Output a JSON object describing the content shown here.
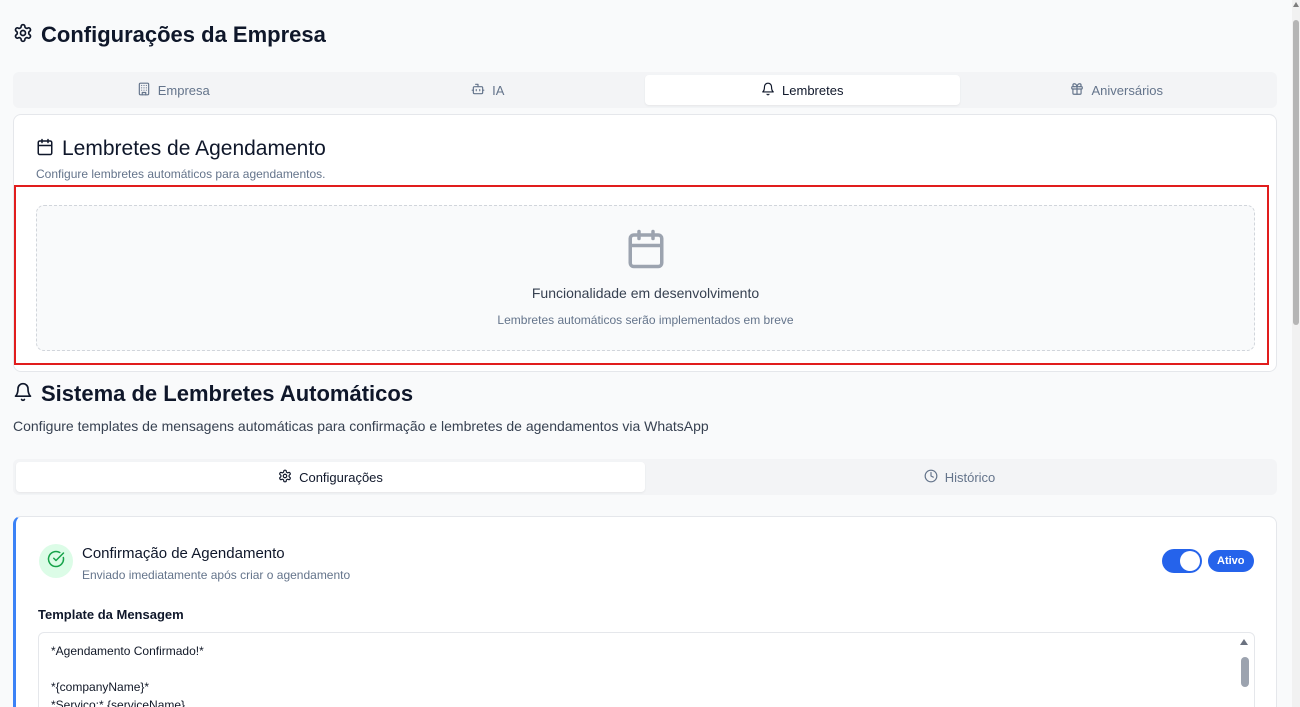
{
  "header": {
    "title": "Configurações da Empresa",
    "icon": "gear-icon"
  },
  "tabs": [
    {
      "label": "Empresa",
      "icon": "building-icon",
      "active": false
    },
    {
      "label": "IA",
      "icon": "bot-icon",
      "active": false
    },
    {
      "label": "Lembretes",
      "icon": "bell-icon",
      "active": true
    },
    {
      "label": "Aniversários",
      "icon": "gift-icon",
      "active": false
    }
  ],
  "scheduling_card": {
    "title": "Lembretes de Agendamento",
    "subtitle": "Configure lembretes automáticos para agendamentos.",
    "placeholder_title": "Funcionalidade em desenvolvimento",
    "placeholder_subtitle": "Lembretes automáticos serão implementados em breve"
  },
  "system": {
    "title": "Sistema de Lembretes Automáticos",
    "subtitle": "Configure templates de mensagens automáticas para confirmação e lembretes de agendamentos via WhatsApp"
  },
  "subtabs": [
    {
      "label": "Configurações",
      "icon": "gear-icon",
      "active": true
    },
    {
      "label": "Histórico",
      "icon": "clock-icon",
      "active": false
    }
  ],
  "reminder": {
    "title": "Confirmação de Agendamento",
    "subtitle": "Enviado imediatamente após criar o agendamento",
    "status": "Ativo",
    "enabled": true,
    "template_label": "Template da Mensagem",
    "template_lines": [
      "*Agendamento Confirmado!*",
      "",
      "*{companyName}*",
      "*Serviço:* {serviceName}"
    ]
  },
  "colors": {
    "accent": "#2563eb",
    "highlight": "#e11d1d",
    "success_bg": "#dcfce7",
    "success": "#16a34a"
  }
}
